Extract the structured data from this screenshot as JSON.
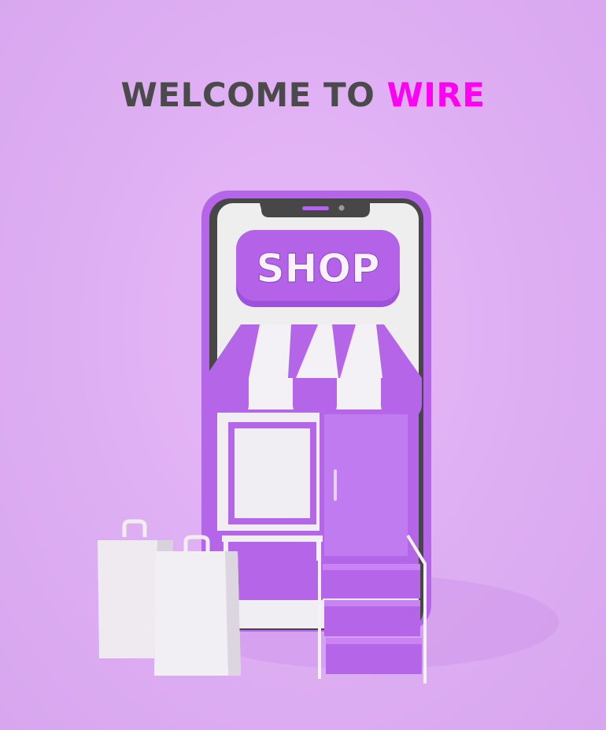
{
  "headline": {
    "prefix": "WELCOME TO ",
    "brand": "WIRE"
  },
  "shop_sign": {
    "label": "SHOP"
  },
  "colors": {
    "background": "#deaef3",
    "accent": "#ff00f2",
    "purple": "#b061e6",
    "headline_text": "#4a4a4a"
  }
}
